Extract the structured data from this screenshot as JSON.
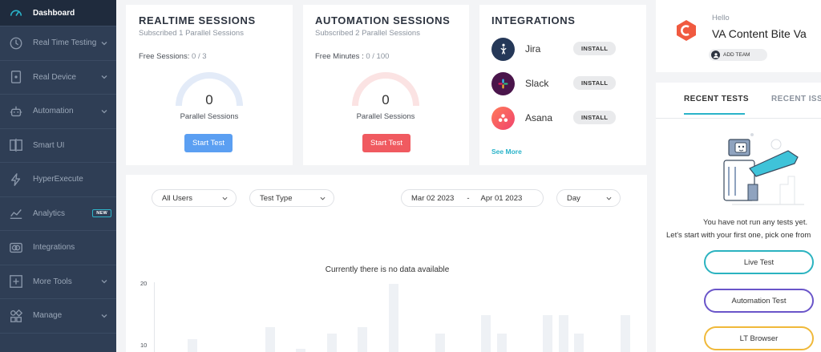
{
  "sidebar": {
    "items": [
      {
        "label": "Dashboard",
        "icon": "gauge-icon"
      },
      {
        "label": "Real Time Testing",
        "icon": "clock-icon"
      },
      {
        "label": "Real Device",
        "icon": "mobile-device-icon"
      },
      {
        "label": "Automation",
        "icon": "robot-icon"
      },
      {
        "label": "Smart UI",
        "icon": "smart-ui-icon"
      },
      {
        "label": "HyperExecute",
        "icon": "lightning-icon"
      },
      {
        "label": "Analytics",
        "icon": "analytics-icon",
        "badge": "NEW"
      },
      {
        "label": "Integrations",
        "icon": "integrations-icon"
      },
      {
        "label": "More Tools",
        "icon": "plus-box-icon"
      },
      {
        "label": "Manage",
        "icon": "manage-icon"
      }
    ]
  },
  "realtime": {
    "title": "REALTIME SESSIONS",
    "subtitle": "Subscribed 1 Parallel Sessions",
    "free_label": "Free Sessions:",
    "free_value": "0 / 3",
    "gauge_value": "0",
    "gauge_label": "Parallel Sessions",
    "button": "Start Test"
  },
  "automation": {
    "title": "AUTOMATION SESSIONS",
    "subtitle": "Subscribed 2 Parallel Sessions",
    "free_label": "Free Minutes :",
    "free_value": "0 / 100",
    "gauge_value": "0",
    "gauge_label": "Parallel Sessions",
    "button": "Start Test"
  },
  "integrations": {
    "title": "INTEGRATIONS",
    "items": [
      {
        "name": "Jira",
        "action": "INSTALL",
        "icon": "jira-icon"
      },
      {
        "name": "Slack",
        "action": "INSTALL",
        "icon": "slack-icon"
      },
      {
        "name": "Asana",
        "action": "INSTALL",
        "icon": "asana-icon"
      }
    ],
    "see_more": "See More"
  },
  "profile": {
    "greeting": "Hello",
    "name": "VA Content Bite Va",
    "add_team": "ADD TEAM"
  },
  "filters": {
    "users": "All Users",
    "test_type": "Test Type",
    "date_from": "Mar 02 2023",
    "date_sep": "-",
    "date_to": "Apr 01 2023",
    "granularity": "Day"
  },
  "chart": {
    "message": "Currently there is no data available",
    "y_ticks": [
      "20",
      "10"
    ]
  },
  "tests_panel": {
    "tabs": [
      "RECENT TESTS",
      "RECENT ISSU"
    ],
    "empty_line1": "You have not run any tests yet.",
    "empty_line2": "Let's start with your first one, pick one from",
    "buttons": [
      "Live Test",
      "Automation Test",
      "LT Browser"
    ]
  },
  "colors": {
    "sidebar_bg": "#2f3e55",
    "accent_teal": "#2ab3c9",
    "realtime_button": "#5b9ff2",
    "automation_button": "#f05a60",
    "live_test_border": "#2bb3c0",
    "automation_test_border": "#6a55c9",
    "lt_browser_border": "#f0b93a"
  }
}
